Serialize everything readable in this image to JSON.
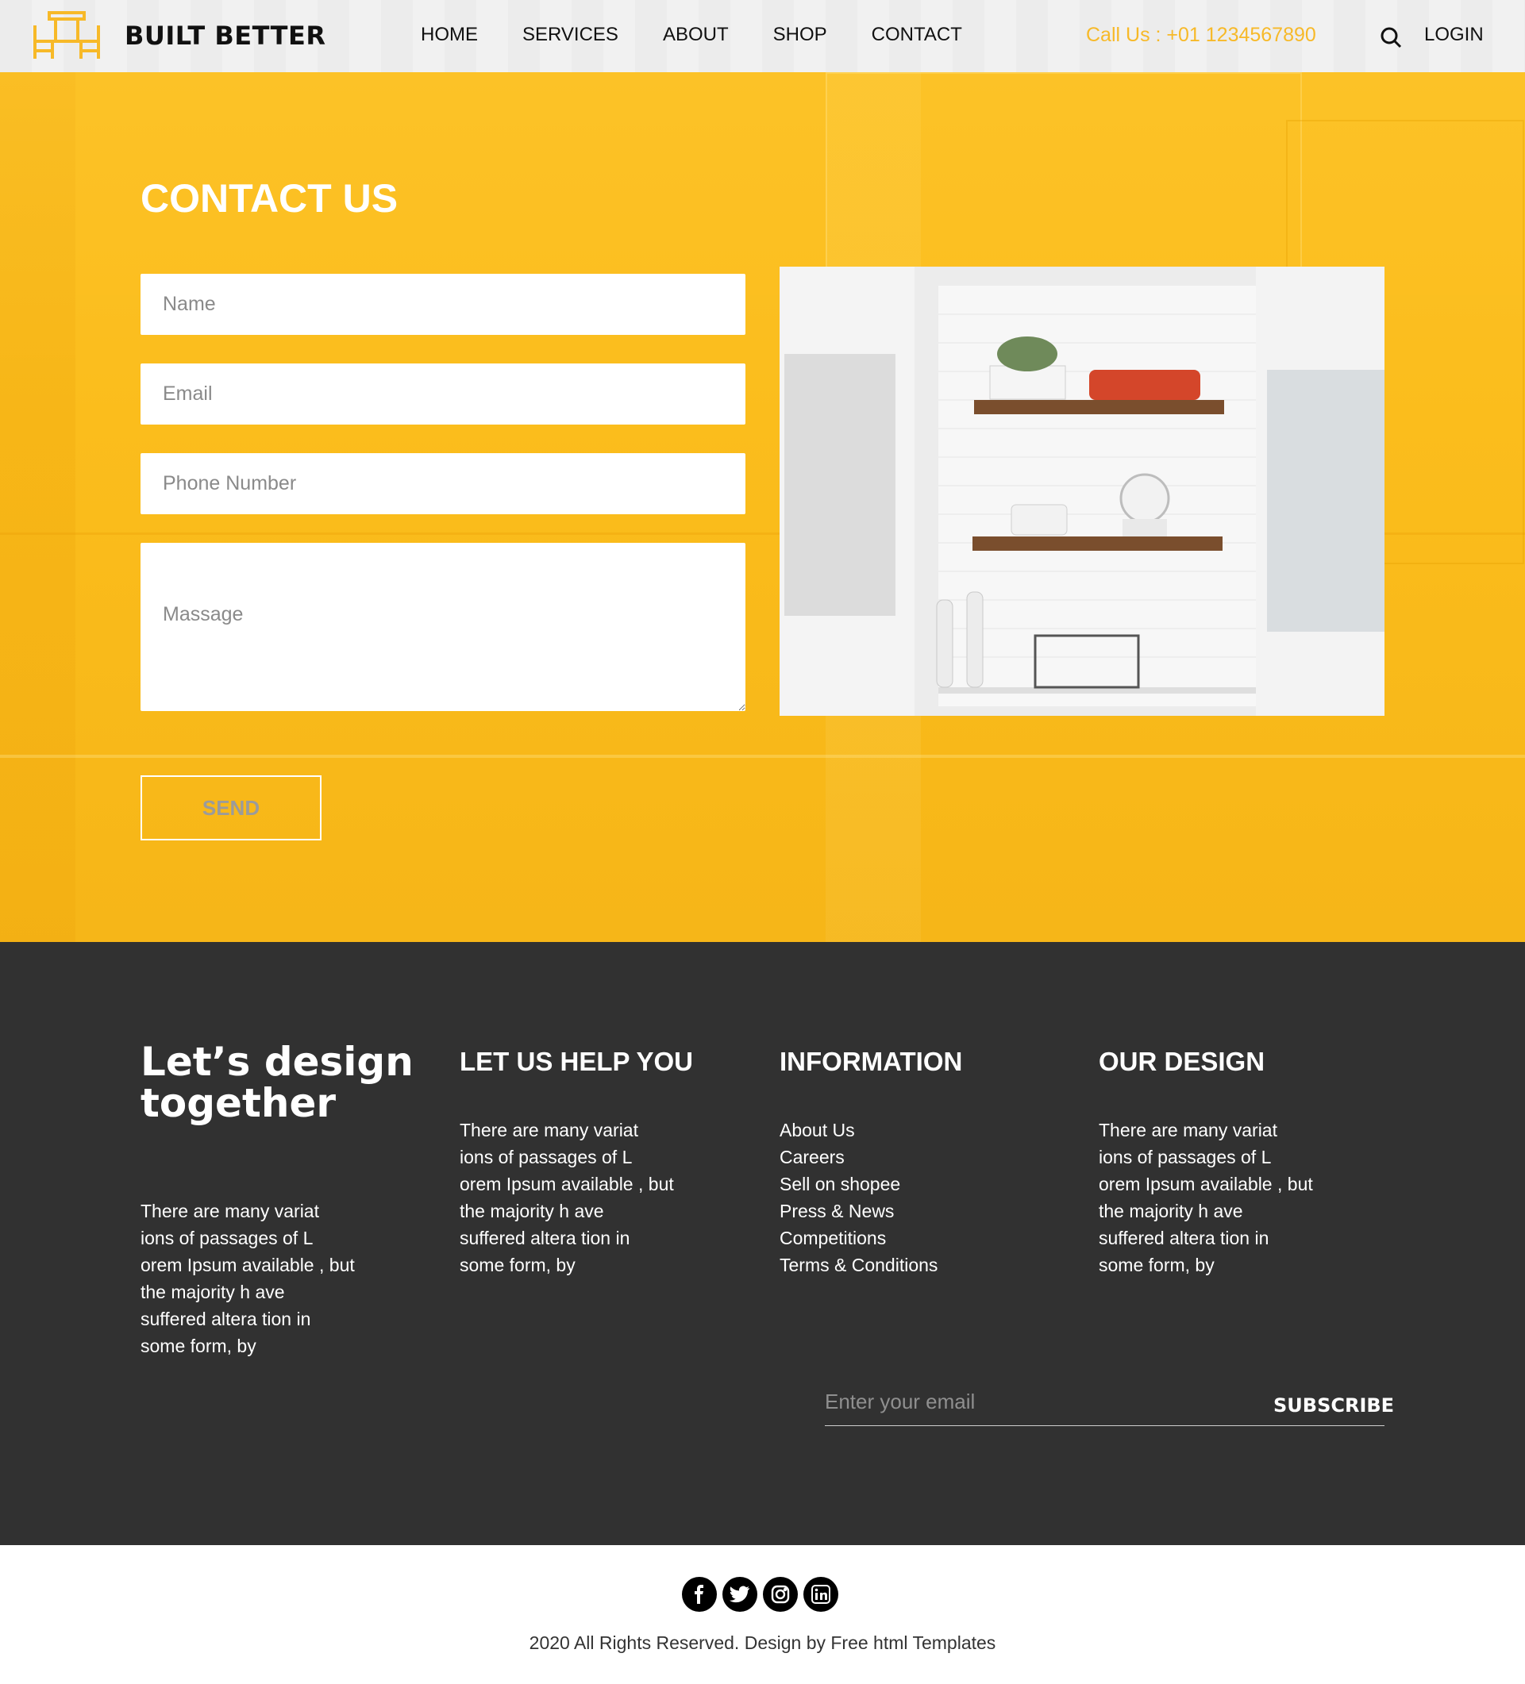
{
  "header": {
    "brand": "BUILT BETTER",
    "nav": [
      "HOME",
      "SERVICES",
      "ABOUT",
      "SHOP",
      "CONTACT"
    ],
    "call": "Call Us : +01 1234567890",
    "login": "LOGIN"
  },
  "contact": {
    "title": "CONTACT US",
    "name_placeholder": "Name",
    "email_placeholder": "Email",
    "phone_placeholder": "Phone Number",
    "message_placeholder": "Massage",
    "send_label": "SEND"
  },
  "footer": {
    "tagline": "Let’s design together",
    "tagline_text": "There are many variat ions of passages of L orem Ipsum available , but the majority h ave suffered altera tion in some form, by",
    "help_title": "LET US HELP YOU",
    "help_text": "There are many variat ions of passages of L orem Ipsum available , but the majority h ave suffered altera tion in some form, by",
    "info_title": "INFORMATION",
    "info_items": [
      "About Us",
      "Careers",
      "Sell on shopee",
      "Press & News",
      "Competitions",
      "Terms & Conditions"
    ],
    "design_title": "OUR DESIGN",
    "design_text": "There are many variat ions of passages of L orem Ipsum available , but the majority h ave suffered altera tion in some form, by",
    "email_placeholder": "Enter your email",
    "subscribe_label": "SUBSCRIBE"
  },
  "bottom": {
    "socials": [
      "facebook-icon",
      "twitter-icon",
      "instagram-icon",
      "linkedin-icon"
    ],
    "copyright": "2020 All Rights Reserved. Design by Free html Templates"
  },
  "colors": {
    "accent": "#fbbd1c",
    "footer_bg": "#313131",
    "call_text": "#f7b928"
  }
}
